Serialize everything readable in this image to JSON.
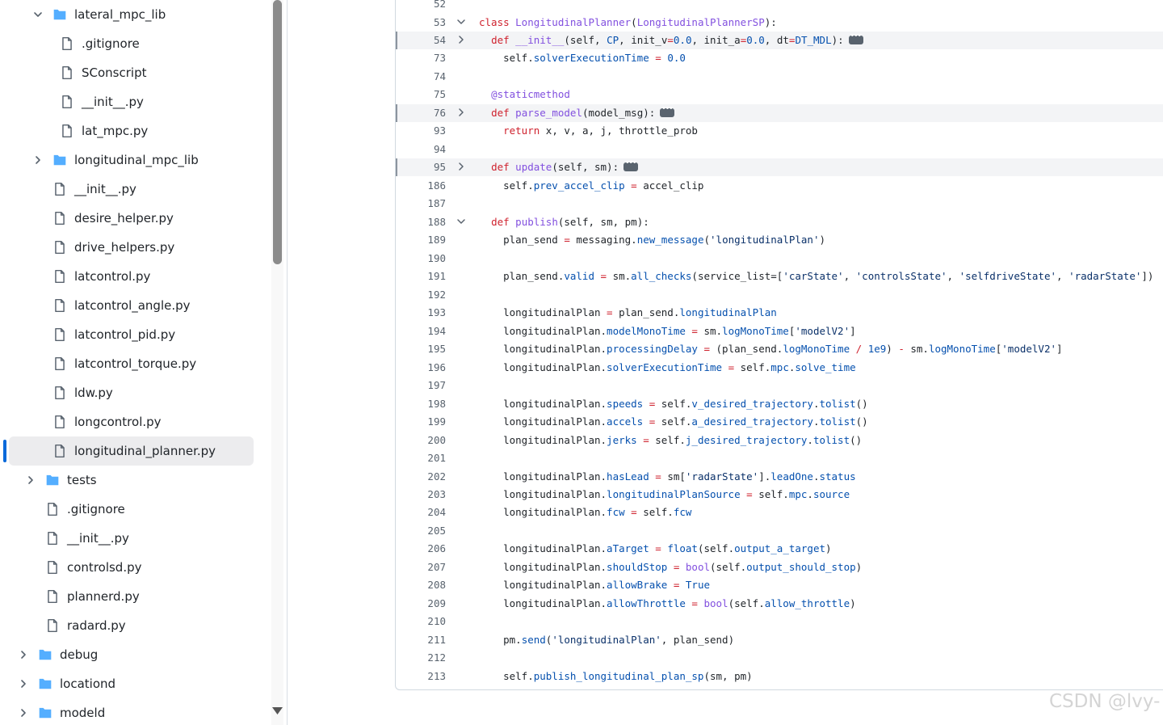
{
  "file_tree": {
    "items": [
      {
        "label": "lateral_mpc_lib",
        "type": "folder",
        "expanded": true,
        "icon": "folder-icon"
      },
      {
        "label": ".gitignore",
        "type": "file",
        "icon": "file-icon"
      },
      {
        "label": "SConscript",
        "type": "file",
        "icon": "file-icon"
      },
      {
        "label": "__init__.py",
        "type": "file",
        "icon": "file-icon"
      },
      {
        "label": "lat_mpc.py",
        "type": "file",
        "icon": "file-icon"
      },
      {
        "label": "longitudinal_mpc_lib",
        "type": "folder",
        "expanded": false,
        "icon": "folder-icon"
      },
      {
        "label": "__init__.py",
        "type": "file",
        "icon": "file-icon"
      },
      {
        "label": "desire_helper.py",
        "type": "file",
        "icon": "file-icon"
      },
      {
        "label": "drive_helpers.py",
        "type": "file",
        "icon": "file-icon"
      },
      {
        "label": "latcontrol.py",
        "type": "file",
        "icon": "file-icon"
      },
      {
        "label": "latcontrol_angle.py",
        "type": "file",
        "icon": "file-icon"
      },
      {
        "label": "latcontrol_pid.py",
        "type": "file",
        "icon": "file-icon"
      },
      {
        "label": "latcontrol_torque.py",
        "type": "file",
        "icon": "file-icon"
      },
      {
        "label": "ldw.py",
        "type": "file",
        "icon": "file-icon"
      },
      {
        "label": "longcontrol.py",
        "type": "file",
        "icon": "file-icon"
      },
      {
        "label": "longitudinal_planner.py",
        "type": "file",
        "icon": "file-icon",
        "selected": true
      },
      {
        "label": "tests",
        "type": "folder",
        "expanded": false,
        "icon": "folder-icon"
      },
      {
        "label": ".gitignore",
        "type": "file",
        "icon": "file-icon"
      },
      {
        "label": "__init__.py",
        "type": "file",
        "icon": "file-icon"
      },
      {
        "label": "controlsd.py",
        "type": "file",
        "icon": "file-icon"
      },
      {
        "label": "plannerd.py",
        "type": "file",
        "icon": "file-icon"
      },
      {
        "label": "radard.py",
        "type": "file",
        "icon": "file-icon"
      },
      {
        "label": "debug",
        "type": "folder",
        "expanded": false,
        "icon": "folder-icon"
      },
      {
        "label": "locationd",
        "type": "folder",
        "expanded": false,
        "icon": "folder-icon"
      },
      {
        "label": "modeld",
        "type": "folder",
        "expanded": false,
        "icon": "folder-icon"
      }
    ]
  },
  "code": {
    "lines": [
      {
        "num": "52",
        "fold": "",
        "folded": false,
        "tokens": []
      },
      {
        "num": "53",
        "fold": "down",
        "folded": false,
        "tokens": [
          [
            "kw",
            "class "
          ],
          [
            "fn",
            "LongitudinalPlanner"
          ],
          [
            "",
            "("
          ],
          [
            "fn",
            "LongitudinalPlannerSP"
          ],
          [
            "",
            "):"
          ]
        ]
      },
      {
        "num": "54",
        "fold": "right",
        "folded": true,
        "ellipsis": true,
        "tokens": [
          [
            "",
            "  "
          ],
          [
            "kw",
            "def "
          ],
          [
            "fn",
            "__init__"
          ],
          [
            "",
            "(self, "
          ],
          [
            "pr",
            "CP"
          ],
          [
            "",
            ", init_v"
          ],
          [
            "kw",
            "="
          ],
          [
            "pr",
            "0.0"
          ],
          [
            "",
            ", init_a"
          ],
          [
            "kw",
            "="
          ],
          [
            "pr",
            "0.0"
          ],
          [
            "",
            ", dt"
          ],
          [
            "kw",
            "="
          ],
          [
            "pr",
            "DT_MDL"
          ],
          [
            "",
            "):"
          ]
        ]
      },
      {
        "num": "73",
        "fold": "",
        "folded": false,
        "tokens": [
          [
            "",
            "    self."
          ],
          [
            "pr",
            "solverExecutionTime"
          ],
          [
            "kw",
            " = "
          ],
          [
            "pr",
            "0.0"
          ]
        ]
      },
      {
        "num": "74",
        "fold": "",
        "folded": false,
        "tokens": []
      },
      {
        "num": "75",
        "fold": "",
        "folded": false,
        "tokens": [
          [
            "",
            "  "
          ],
          [
            "fn",
            "@staticmethod"
          ]
        ]
      },
      {
        "num": "76",
        "fold": "right",
        "folded": true,
        "ellipsis": true,
        "tokens": [
          [
            "",
            "  "
          ],
          [
            "kw",
            "def "
          ],
          [
            "fn",
            "parse_model"
          ],
          [
            "",
            "(model_msg):"
          ]
        ]
      },
      {
        "num": "93",
        "fold": "",
        "folded": false,
        "tokens": [
          [
            "",
            "    "
          ],
          [
            "kw",
            "return "
          ],
          [
            "",
            "x, v, a, j, throttle_prob"
          ]
        ]
      },
      {
        "num": "94",
        "fold": "",
        "folded": false,
        "tokens": []
      },
      {
        "num": "95",
        "fold": "right",
        "folded": true,
        "ellipsis": true,
        "tokens": [
          [
            "",
            "  "
          ],
          [
            "kw",
            "def "
          ],
          [
            "fn",
            "update"
          ],
          [
            "",
            "(self, sm):"
          ]
        ]
      },
      {
        "num": "186",
        "fold": "",
        "folded": false,
        "tokens": [
          [
            "",
            "    self."
          ],
          [
            "pr",
            "prev_accel_clip"
          ],
          [
            "kw",
            " = "
          ],
          [
            "",
            "accel_clip"
          ]
        ]
      },
      {
        "num": "187",
        "fold": "",
        "folded": false,
        "tokens": []
      },
      {
        "num": "188",
        "fold": "down",
        "folded": false,
        "tokens": [
          [
            "",
            "  "
          ],
          [
            "kw",
            "def "
          ],
          [
            "fn",
            "publish"
          ],
          [
            "",
            "(self, sm, pm):"
          ]
        ]
      },
      {
        "num": "189",
        "fold": "",
        "folded": false,
        "tokens": [
          [
            "",
            "    plan_send "
          ],
          [
            "kw",
            "="
          ],
          [
            "",
            " messaging."
          ],
          [
            "pr",
            "new_message"
          ],
          [
            "",
            "("
          ],
          [
            "st",
            "'longitudinalPlan'"
          ],
          [
            "",
            ")"
          ]
        ]
      },
      {
        "num": "190",
        "fold": "",
        "folded": false,
        "tokens": []
      },
      {
        "num": "191",
        "fold": "",
        "folded": false,
        "tokens": [
          [
            "",
            "    plan_send."
          ],
          [
            "pr",
            "valid"
          ],
          [
            "kw",
            " = "
          ],
          [
            "",
            "sm."
          ],
          [
            "pr",
            "all_checks"
          ],
          [
            "",
            "(service_list=["
          ],
          [
            "st",
            "'carState'"
          ],
          [
            "",
            ", "
          ],
          [
            "st",
            "'controlsState'"
          ],
          [
            "",
            ", "
          ],
          [
            "st",
            "'selfdriveState'"
          ],
          [
            "",
            ", "
          ],
          [
            "st",
            "'radarState'"
          ],
          [
            "",
            "])"
          ]
        ]
      },
      {
        "num": "192",
        "fold": "",
        "folded": false,
        "tokens": []
      },
      {
        "num": "193",
        "fold": "",
        "folded": false,
        "tokens": [
          [
            "",
            "    longitudinalPlan "
          ],
          [
            "kw",
            "="
          ],
          [
            "",
            " plan_send."
          ],
          [
            "pr",
            "longitudinalPlan"
          ]
        ]
      },
      {
        "num": "194",
        "fold": "",
        "folded": false,
        "tokens": [
          [
            "",
            "    longitudinalPlan."
          ],
          [
            "pr",
            "modelMonoTime"
          ],
          [
            "kw",
            " = "
          ],
          [
            "",
            "sm."
          ],
          [
            "pr",
            "logMonoTime"
          ],
          [
            "",
            "["
          ],
          [
            "st",
            "'modelV2'"
          ],
          [
            "",
            "]"
          ]
        ]
      },
      {
        "num": "195",
        "fold": "",
        "folded": false,
        "tokens": [
          [
            "",
            "    longitudinalPlan."
          ],
          [
            "pr",
            "processingDelay"
          ],
          [
            "kw",
            " = "
          ],
          [
            "",
            "(plan_send."
          ],
          [
            "pr",
            "logMonoTime"
          ],
          [
            "kw",
            " / "
          ],
          [
            "pr",
            "1e9"
          ],
          [
            "",
            ")"
          ],
          [
            "kw",
            " - "
          ],
          [
            "",
            "sm."
          ],
          [
            "pr",
            "logMonoTime"
          ],
          [
            "",
            "["
          ],
          [
            "st",
            "'modelV2'"
          ],
          [
            "",
            "]"
          ]
        ]
      },
      {
        "num": "196",
        "fold": "",
        "folded": false,
        "tokens": [
          [
            "",
            "    longitudinalPlan."
          ],
          [
            "pr",
            "solverExecutionTime"
          ],
          [
            "kw",
            " = "
          ],
          [
            "",
            "self."
          ],
          [
            "pr",
            "mpc"
          ],
          [
            "",
            "."
          ],
          [
            "pr",
            "solve_time"
          ]
        ]
      },
      {
        "num": "197",
        "fold": "",
        "folded": false,
        "tokens": []
      },
      {
        "num": "198",
        "fold": "",
        "folded": false,
        "tokens": [
          [
            "",
            "    longitudinalPlan."
          ],
          [
            "pr",
            "speeds"
          ],
          [
            "kw",
            " = "
          ],
          [
            "",
            "self."
          ],
          [
            "pr",
            "v_desired_trajectory"
          ],
          [
            "",
            "."
          ],
          [
            "pr",
            "tolist"
          ],
          [
            "",
            "()"
          ]
        ]
      },
      {
        "num": "199",
        "fold": "",
        "folded": false,
        "tokens": [
          [
            "",
            "    longitudinalPlan."
          ],
          [
            "pr",
            "accels"
          ],
          [
            "kw",
            " = "
          ],
          [
            "",
            "self."
          ],
          [
            "pr",
            "a_desired_trajectory"
          ],
          [
            "",
            "."
          ],
          [
            "pr",
            "tolist"
          ],
          [
            "",
            "()"
          ]
        ]
      },
      {
        "num": "200",
        "fold": "",
        "folded": false,
        "tokens": [
          [
            "",
            "    longitudinalPlan."
          ],
          [
            "pr",
            "jerks"
          ],
          [
            "kw",
            " = "
          ],
          [
            "",
            "self."
          ],
          [
            "pr",
            "j_desired_trajectory"
          ],
          [
            "",
            "."
          ],
          [
            "pr",
            "tolist"
          ],
          [
            "",
            "()"
          ]
        ]
      },
      {
        "num": "201",
        "fold": "",
        "folded": false,
        "tokens": []
      },
      {
        "num": "202",
        "fold": "",
        "folded": false,
        "tokens": [
          [
            "",
            "    longitudinalPlan."
          ],
          [
            "pr",
            "hasLead"
          ],
          [
            "kw",
            " = "
          ],
          [
            "",
            "sm["
          ],
          [
            "st",
            "'radarState'"
          ],
          [
            "",
            "]."
          ],
          [
            "pr",
            "leadOne"
          ],
          [
            "",
            "."
          ],
          [
            "pr",
            "status"
          ]
        ]
      },
      {
        "num": "203",
        "fold": "",
        "folded": false,
        "tokens": [
          [
            "",
            "    longitudinalPlan."
          ],
          [
            "pr",
            "longitudinalPlanSource"
          ],
          [
            "kw",
            " = "
          ],
          [
            "",
            "self."
          ],
          [
            "pr",
            "mpc"
          ],
          [
            "",
            "."
          ],
          [
            "pr",
            "source"
          ]
        ]
      },
      {
        "num": "204",
        "fold": "",
        "folded": false,
        "tokens": [
          [
            "",
            "    longitudinalPlan."
          ],
          [
            "pr",
            "fcw"
          ],
          [
            "kw",
            " = "
          ],
          [
            "",
            "self."
          ],
          [
            "pr",
            "fcw"
          ]
        ]
      },
      {
        "num": "205",
        "fold": "",
        "folded": false,
        "tokens": []
      },
      {
        "num": "206",
        "fold": "",
        "folded": false,
        "tokens": [
          [
            "",
            "    longitudinalPlan."
          ],
          [
            "pr",
            "aTarget"
          ],
          [
            "kw",
            " = "
          ],
          [
            "pr",
            "float"
          ],
          [
            "",
            "(self."
          ],
          [
            "pr",
            "output_a_target"
          ],
          [
            "",
            ")"
          ]
        ]
      },
      {
        "num": "207",
        "fold": "",
        "folded": false,
        "tokens": [
          [
            "",
            "    longitudinalPlan."
          ],
          [
            "pr",
            "shouldStop"
          ],
          [
            "kw",
            " = "
          ],
          [
            "fn",
            "bool"
          ],
          [
            "",
            "(self."
          ],
          [
            "pr",
            "output_should_stop"
          ],
          [
            "",
            ")"
          ]
        ]
      },
      {
        "num": "208",
        "fold": "",
        "folded": false,
        "tokens": [
          [
            "",
            "    longitudinalPlan."
          ],
          [
            "pr",
            "allowBrake"
          ],
          [
            "kw",
            " = "
          ],
          [
            "pr",
            "True"
          ]
        ]
      },
      {
        "num": "209",
        "fold": "",
        "folded": false,
        "tokens": [
          [
            "",
            "    longitudinalPlan."
          ],
          [
            "pr",
            "allowThrottle"
          ],
          [
            "kw",
            " = "
          ],
          [
            "fn",
            "bool"
          ],
          [
            "",
            "(self."
          ],
          [
            "pr",
            "allow_throttle"
          ],
          [
            "",
            ")"
          ]
        ]
      },
      {
        "num": "210",
        "fold": "",
        "folded": false,
        "tokens": []
      },
      {
        "num": "211",
        "fold": "",
        "folded": false,
        "tokens": [
          [
            "",
            "    pm."
          ],
          [
            "pr",
            "send"
          ],
          [
            "",
            "("
          ],
          [
            "st",
            "'longitudinalPlan'"
          ],
          [
            "",
            ", plan_send)"
          ]
        ]
      },
      {
        "num": "212",
        "fold": "",
        "folded": false,
        "tokens": []
      },
      {
        "num": "213",
        "fold": "",
        "folded": false,
        "tokens": [
          [
            "",
            "    self."
          ],
          [
            "pr",
            "publish_longitudinal_plan_sp"
          ],
          [
            "",
            "(sm, pm)"
          ]
        ]
      }
    ]
  },
  "watermark": "CSDN @lvy-",
  "colors": {
    "accent": "#0969da",
    "folder": "#54aeff",
    "keyword": "#cf222e",
    "function": "#8250df",
    "property": "#0550ae",
    "string": "#0a3069"
  }
}
